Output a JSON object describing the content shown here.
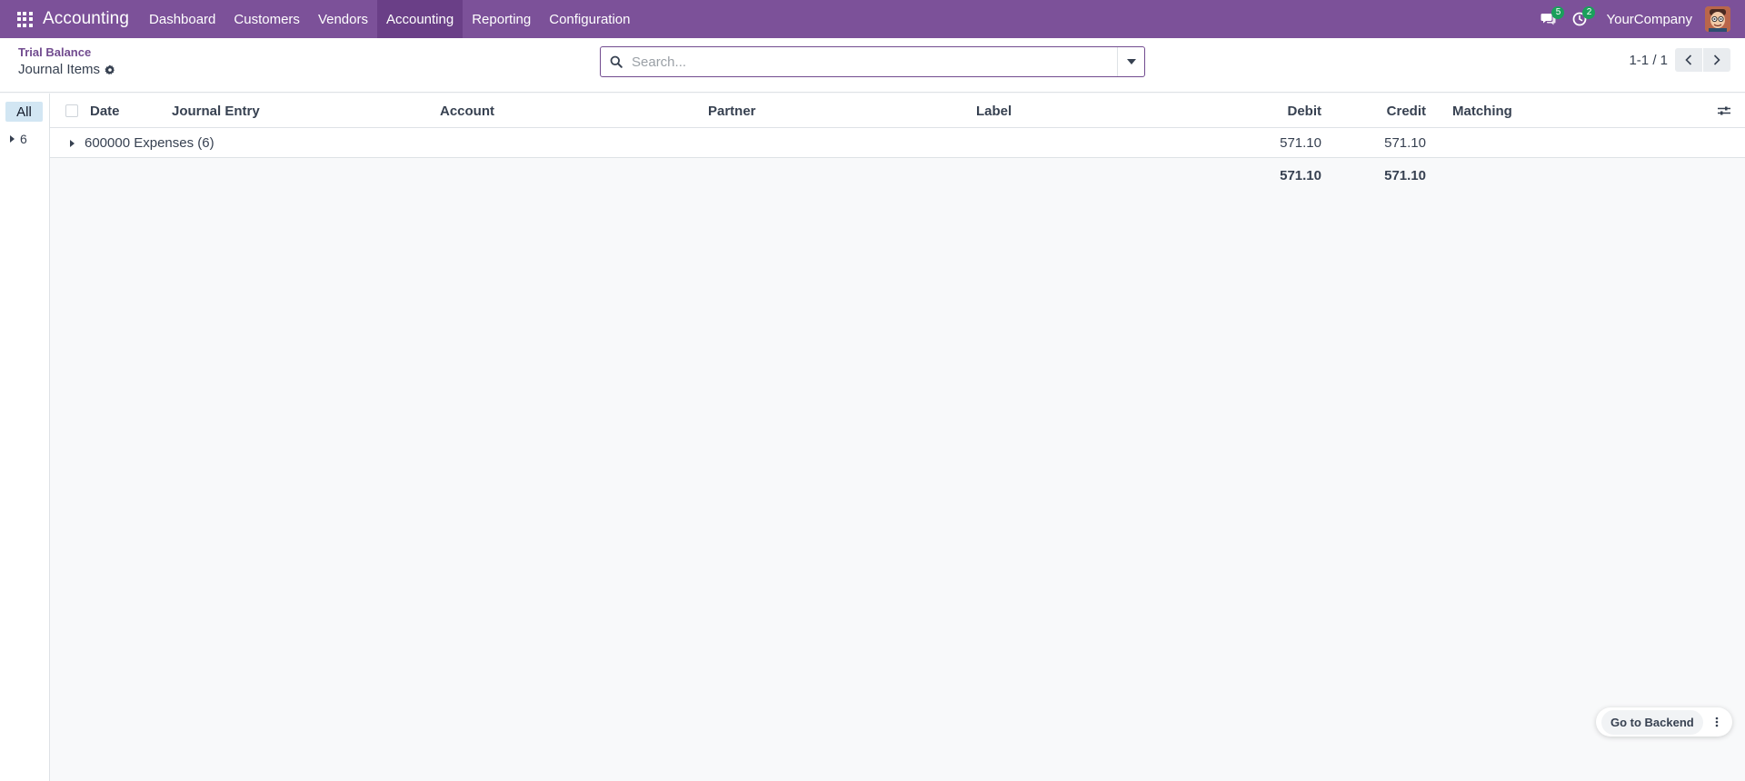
{
  "navbar": {
    "app_name": "Accounting",
    "menu": [
      {
        "label": "Dashboard"
      },
      {
        "label": "Customers"
      },
      {
        "label": "Vendors"
      },
      {
        "label": "Accounting",
        "active": true
      },
      {
        "label": "Reporting"
      },
      {
        "label": "Configuration"
      }
    ],
    "messages_count": "5",
    "activities_count": "2",
    "company": "YourCompany",
    "icons": {
      "apps": "apps-grid-icon",
      "messages": "chat-bubbles-icon",
      "activities": "clock-icon"
    }
  },
  "control": {
    "breadcrumb": "Trial Balance",
    "title": "Journal Items",
    "search_placeholder": "Search...",
    "pager": "1-1 / 1"
  },
  "side_panel": {
    "all_label": "All",
    "items": [
      {
        "label": "6"
      }
    ]
  },
  "list": {
    "columns": [
      "Date",
      "Journal Entry",
      "Account",
      "Partner",
      "Label",
      "Debit",
      "Credit",
      "Matching"
    ],
    "groups": [
      {
        "label": "600000 Expenses (6)",
        "debit": "571.10",
        "credit": "571.10"
      }
    ],
    "totals": {
      "debit": "571.10",
      "credit": "571.10"
    }
  },
  "backend": {
    "label": "Go to Backend"
  },
  "colors": {
    "navbar": "#7c5199",
    "accent": "#714b8f",
    "badge": "#1aa05b",
    "side_active": "#d2e6f3"
  }
}
